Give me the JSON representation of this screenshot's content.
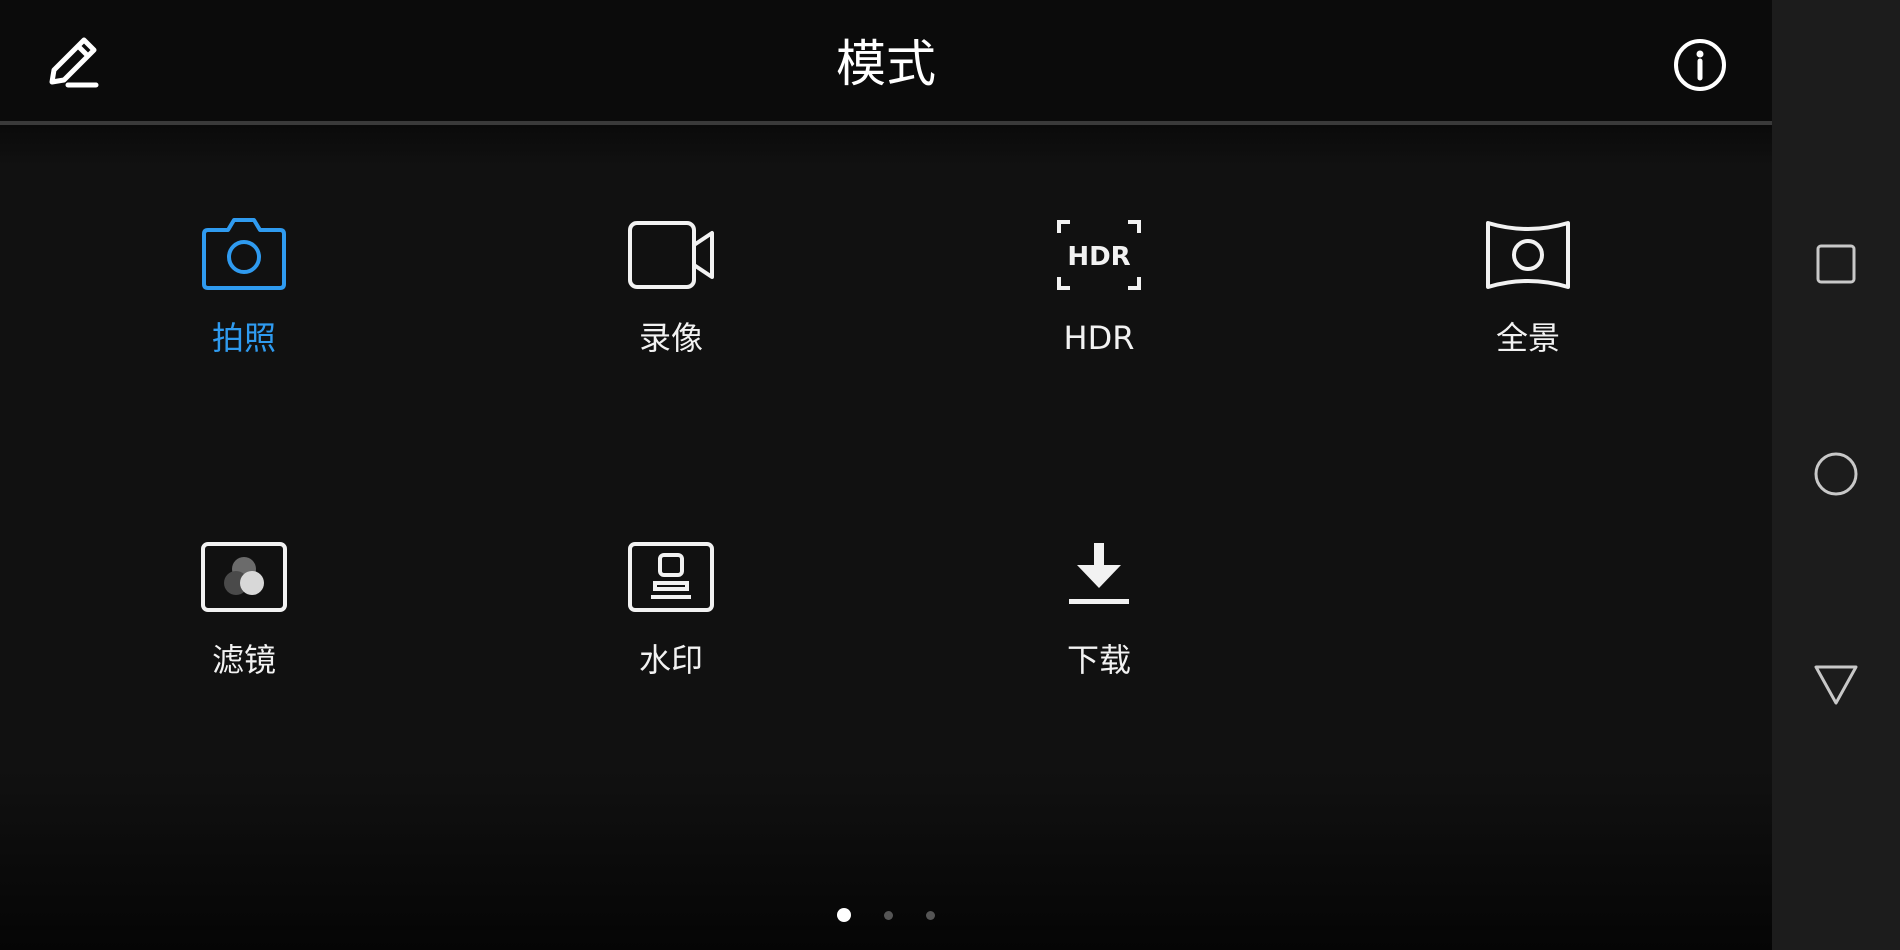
{
  "header": {
    "title": "模式",
    "edit_icon": "edit-pencil-icon",
    "info_icon": "info-icon"
  },
  "modes": [
    {
      "label": "拍照",
      "icon": "camera-icon",
      "selected": true
    },
    {
      "label": "录像",
      "icon": "video-camera-icon",
      "selected": false
    },
    {
      "label": "HDR",
      "icon": "hdr-icon",
      "icon_text": "HDR",
      "selected": false
    },
    {
      "label": "全景",
      "icon": "panorama-icon",
      "selected": false
    },
    {
      "label": "滤镜",
      "icon": "filter-icon",
      "selected": false
    },
    {
      "label": "水印",
      "icon": "watermark-stamp-icon",
      "selected": false
    },
    {
      "label": "下载",
      "icon": "download-icon",
      "selected": false
    }
  ],
  "pagination": {
    "pages": 3,
    "current": 1
  },
  "navigation_bar": {
    "buttons": [
      "recent-apps-icon",
      "home-icon",
      "back-icon"
    ]
  },
  "colors": {
    "accent": "#2f9bf0",
    "background": "#111111",
    "header_background": "#0b0b0b",
    "text": "#f2f2f2",
    "navbar_background": "#1c1c1c"
  }
}
